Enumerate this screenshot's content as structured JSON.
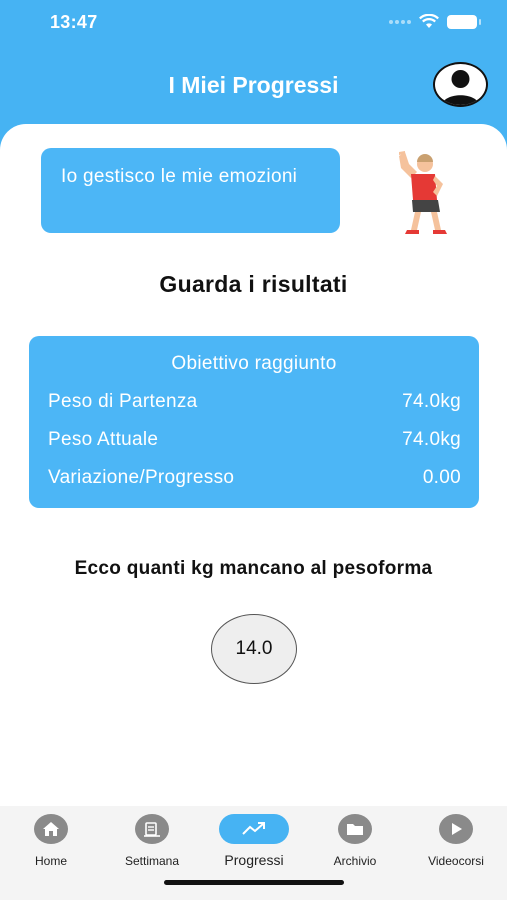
{
  "status_bar": {
    "time": "13:47"
  },
  "header": {
    "title": "I Miei Progressi",
    "avatar_icon": "user-avatar-icon"
  },
  "motto": {
    "text": "Io gestisco le mie emozioni",
    "illustration": "stretching-person-icon"
  },
  "section_title": "Guarda i risultati",
  "results": {
    "status": "Obiettivo raggiunto",
    "rows": [
      {
        "label": "Peso di Partenza",
        "value": "74.0kg"
      },
      {
        "label": "Peso Attuale",
        "value": "74.0kg"
      },
      {
        "label": "Variazione/Progresso",
        "value": "0.00"
      }
    ]
  },
  "remaining": {
    "label": "Ecco quanti kg mancano al pesoforma",
    "value": "14.0"
  },
  "tabs": [
    {
      "label": "Home",
      "icon": "home-icon",
      "active": false
    },
    {
      "label": "Settimana",
      "icon": "menu-plate-icon",
      "active": false
    },
    {
      "label": "Progressi",
      "icon": "trend-up-icon",
      "active": true
    },
    {
      "label": "Archivio",
      "icon": "folder-icon",
      "active": false
    },
    {
      "label": "Videocorsi",
      "icon": "play-icon",
      "active": false
    }
  ],
  "colors": {
    "primary": "#46b3f3",
    "card": "#4cb6f6",
    "tab_bar": "#f4f4f4"
  }
}
